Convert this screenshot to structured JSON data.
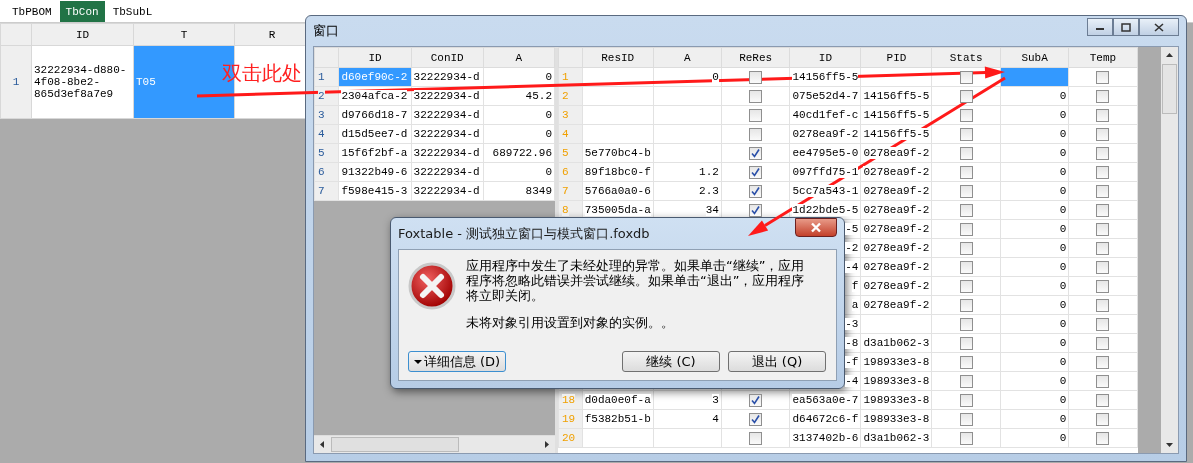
{
  "app": {
    "tabs": [
      {
        "label": "TbPBOM",
        "selected": false
      },
      {
        "label": "TbCon",
        "selected": true
      },
      {
        "label": "TbSubL",
        "selected": false
      }
    ],
    "table": {
      "columns": [
        "ID",
        "T",
        "R"
      ],
      "rows": [
        {
          "number": "1",
          "cells": [
            {
              "text": "32222934-d880-4f08-8be2-865d3ef8a7e9",
              "selected": false
            },
            {
              "text": "T05",
              "selected": true
            },
            {
              "selected": false
            }
          ]
        }
      ]
    },
    "note": "双击此处"
  },
  "window": {
    "title": "窗口",
    "grids": [
      {
        "columns": [
          {
            "label": "ID",
            "kind": "text"
          },
          {
            "label": "ConID",
            "kind": "text"
          },
          {
            "label": "A",
            "kind": "number"
          }
        ],
        "rows": [
          {
            "number": "1",
            "cells": [
              {
                "text": "d60ef90c-2",
                "selected": true
              },
              {
                "text": "32222934-d",
                "selected": false
              },
              {
                "text": "0",
                "selected": false
              }
            ]
          },
          {
            "number": "2",
            "cells": [
              {
                "text": "2304afca-2",
                "selected": false
              },
              {
                "text": "32222934-d",
                "selected": false
              },
              {
                "text": "45.2",
                "selected": false
              }
            ]
          },
          {
            "number": "3",
            "cells": [
              {
                "text": "d9766d18-7",
                "selected": false
              },
              {
                "text": "32222934-d",
                "selected": false
              },
              {
                "text": "0",
                "selected": false
              }
            ]
          },
          {
            "number": "4",
            "cells": [
              {
                "text": "d15d5ee7-d",
                "selected": false
              },
              {
                "text": "32222934-d",
                "selected": false
              },
              {
                "text": "0",
                "selected": false
              }
            ]
          },
          {
            "number": "5",
            "cells": [
              {
                "text": "15f6f2bf-a",
                "selected": false
              },
              {
                "text": "32222934-d",
                "selected": false
              },
              {
                "text": "689722.96",
                "selected": false
              }
            ]
          },
          {
            "number": "6",
            "cells": [
              {
                "text": "91322b49-6",
                "selected": false
              },
              {
                "text": "32222934-d",
                "selected": false
              },
              {
                "text": "0",
                "selected": false
              }
            ]
          },
          {
            "number": "7",
            "cells": [
              {
                "text": "f598e415-3",
                "selected": false
              },
              {
                "text": "32222934-d",
                "selected": false
              },
              {
                "text": "8349",
                "selected": false
              }
            ]
          }
        ]
      },
      {
        "columns": [
          {
            "label": "ResID",
            "kind": "text"
          },
          {
            "label": "A",
            "kind": "number"
          },
          {
            "label": "ReRes",
            "kind": "check"
          },
          {
            "label": "ID",
            "kind": "text"
          },
          {
            "label": "PID",
            "kind": "text"
          },
          {
            "label": "Stats",
            "kind": "check"
          },
          {
            "label": "SubA",
            "kind": "number"
          },
          {
            "label": "Temp",
            "kind": "check"
          }
        ],
        "rows": [
          {
            "number": "1",
            "cells": [
              {
                "selected": false
              },
              {
                "text": "0",
                "selected": false
              },
              {
                "checked": false,
                "selected": false
              },
              {
                "text": "14156ff5-5",
                "selected": false
              },
              {
                "selected": false
              },
              {
                "checked": false,
                "selected": false
              },
              {
                "selected": true
              },
              {
                "checked": false,
                "selected": false
              }
            ]
          },
          {
            "number": "2",
            "cells": [
              {
                "selected": false
              },
              {
                "selected": false
              },
              {
                "checked": false,
                "selected": false
              },
              {
                "text": "075e52d4-7",
                "selected": false
              },
              {
                "text": "14156ff5-5",
                "selected": false
              },
              {
                "checked": false,
                "selected": false
              },
              {
                "text": "0",
                "selected": false
              },
              {
                "checked": false,
                "selected": false
              }
            ]
          },
          {
            "number": "3",
            "cells": [
              {
                "selected": false
              },
              {
                "selected": false
              },
              {
                "checked": false,
                "selected": false
              },
              {
                "text": "40cd1fef-c",
                "selected": false
              },
              {
                "text": "14156ff5-5",
                "selected": false
              },
              {
                "checked": false,
                "selected": false
              },
              {
                "text": "0",
                "selected": false
              },
              {
                "checked": false,
                "selected": false
              }
            ]
          },
          {
            "number": "4",
            "cells": [
              {
                "selected": false
              },
              {
                "selected": false
              },
              {
                "checked": false,
                "selected": false
              },
              {
                "text": "0278ea9f-2",
                "selected": false
              },
              {
                "text": "14156ff5-5",
                "selected": false
              },
              {
                "checked": false,
                "selected": false
              },
              {
                "text": "0",
                "selected": false
              },
              {
                "checked": false,
                "selected": false
              }
            ]
          },
          {
            "number": "5",
            "cells": [
              {
                "text": "5e770bc4-b",
                "selected": false
              },
              {
                "selected": false
              },
              {
                "checked": true,
                "selected": false
              },
              {
                "text": "ee4795e5-0",
                "selected": false
              },
              {
                "text": "0278ea9f-2",
                "selected": false
              },
              {
                "checked": false,
                "selected": false
              },
              {
                "text": "0",
                "selected": false
              },
              {
                "checked": false,
                "selected": false
              }
            ]
          },
          {
            "number": "6",
            "cells": [
              {
                "text": "89f18bc0-f",
                "selected": false
              },
              {
                "text": "1.2",
                "selected": false
              },
              {
                "checked": true,
                "selected": false
              },
              {
                "text": "097ffd75-1",
                "selected": false
              },
              {
                "text": "0278ea9f-2",
                "selected": false
              },
              {
                "checked": false,
                "selected": false
              },
              {
                "text": "0",
                "selected": false
              },
              {
                "checked": false,
                "selected": false
              }
            ]
          },
          {
            "number": "7",
            "cells": [
              {
                "text": "5766a0a0-6",
                "selected": false
              },
              {
                "text": "2.3",
                "selected": false
              },
              {
                "checked": true,
                "selected": false
              },
              {
                "text": "5cc7a543-1",
                "selected": false
              },
              {
                "text": "0278ea9f-2",
                "selected": false
              },
              {
                "checked": false,
                "selected": false
              },
              {
                "text": "0",
                "selected": false
              },
              {
                "checked": false,
                "selected": false
              }
            ]
          },
          {
            "number": "8",
            "cells": [
              {
                "text": "735005da-a",
                "selected": false
              },
              {
                "text": "34",
                "selected": false
              },
              {
                "checked": true,
                "selected": false
              },
              {
                "text": "1d22bde5-5",
                "selected": false
              },
              {
                "text": "0278ea9f-2",
                "selected": false
              },
              {
                "checked": false,
                "selected": false
              },
              {
                "text": "0",
                "selected": false
              },
              {
                "checked": false,
                "selected": false
              }
            ]
          },
          {
            "cells": [
              {},
              {},
              {},
              {
                "text": "-5",
                "clipped": true,
                "selected": false
              },
              {
                "text": "0278ea9f-2",
                "selected": false
              },
              {
                "checked": false,
                "selected": false
              },
              {
                "text": "0",
                "selected": false
              },
              {
                "checked": false,
                "selected": false
              }
            ]
          },
          {
            "cells": [
              {},
              {},
              {},
              {
                "text": "-2",
                "clipped": true,
                "selected": false
              },
              {
                "text": "0278ea9f-2",
                "selected": false
              },
              {
                "checked": false,
                "selected": false
              },
              {
                "text": "0",
                "selected": false
              },
              {
                "checked": false,
                "selected": false
              }
            ]
          },
          {
            "cells": [
              {},
              {},
              {},
              {
                "text": "-4",
                "clipped": true,
                "selected": false
              },
              {
                "text": "0278ea9f-2",
                "selected": false
              },
              {
                "checked": false,
                "selected": false
              },
              {
                "text": "0",
                "selected": false
              },
              {
                "checked": false,
                "selected": false
              }
            ]
          },
          {
            "cells": [
              {},
              {},
              {},
              {
                "text": "f",
                "clipped": true,
                "selected": false
              },
              {
                "text": "0278ea9f-2",
                "selected": false
              },
              {
                "checked": false,
                "selected": false
              },
              {
                "text": "0",
                "selected": false
              },
              {
                "checked": false,
                "selected": false
              }
            ]
          },
          {
            "cells": [
              {},
              {},
              {},
              {
                "text": "a",
                "clipped": true,
                "selected": false
              },
              {
                "text": "0278ea9f-2",
                "selected": false
              },
              {
                "checked": false,
                "selected": false
              },
              {
                "text": "0",
                "selected": false
              },
              {
                "checked": false,
                "selected": false
              }
            ]
          },
          {
            "cells": [
              {},
              {},
              {},
              {
                "text": "-3",
                "clipped": true,
                "selected": false
              },
              {
                "selected": false
              },
              {
                "checked": false,
                "selected": false
              },
              {
                "text": "0",
                "selected": false
              },
              {
                "checked": false,
                "selected": false
              }
            ]
          },
          {
            "cells": [
              {},
              {},
              {},
              {
                "text": "-8",
                "clipped": true,
                "selected": false
              },
              {
                "text": "d3a1b062-3",
                "selected": false
              },
              {
                "checked": false,
                "selected": false
              },
              {
                "text": "0",
                "selected": false
              },
              {
                "checked": false,
                "selected": false
              }
            ]
          },
          {
            "cells": [
              {},
              {},
              {},
              {
                "text": "-f",
                "clipped": true,
                "selected": false
              },
              {
                "text": "198933e3-8",
                "selected": false
              },
              {
                "checked": false,
                "selected": false
              },
              {
                "text": "0",
                "selected": false
              },
              {
                "checked": false,
                "selected": false
              }
            ]
          },
          {
            "cells": [
              {},
              {},
              {},
              {
                "text": "-4",
                "clipped": true,
                "selected": false
              },
              {
                "text": "198933e3-8",
                "selected": false
              },
              {
                "checked": false,
                "selected": false
              },
              {
                "text": "0",
                "selected": false
              },
              {
                "checked": false,
                "selected": false
              }
            ]
          },
          {
            "number": "18",
            "cells": [
              {
                "text": "d0da0e0f-a",
                "selected": false
              },
              {
                "text": "3",
                "selected": false
              },
              {
                "checked": true,
                "selected": false
              },
              {
                "text": "ea563a0e-7",
                "selected": false
              },
              {
                "text": "198933e3-8",
                "selected": false
              },
              {
                "checked": false,
                "selected": false
              },
              {
                "text": "0",
                "selected": false
              },
              {
                "checked": false,
                "selected": false
              }
            ]
          },
          {
            "number": "19",
            "cells": [
              {
                "text": "f5382b51-b",
                "selected": false
              },
              {
                "text": "4",
                "selected": false
              },
              {
                "checked": true,
                "selected": false
              },
              {
                "text": "d64672c6-f",
                "selected": false
              },
              {
                "text": "198933e3-8",
                "selected": false
              },
              {
                "checked": false,
                "selected": false
              },
              {
                "text": "0",
                "selected": false
              },
              {
                "checked": false,
                "selected": false
              }
            ]
          },
          {
            "number": "20",
            "cells": [
              {
                "selected": false
              },
              {
                "selected": false
              },
              {
                "checked": false,
                "selected": false
              },
              {
                "text": "3137402b-6",
                "selected": false
              },
              {
                "text": "d3a1b062-3",
                "selected": false
              },
              {
                "checked": false,
                "selected": false
              },
              {
                "text": "0",
                "selected": false
              },
              {
                "checked": false,
                "selected": false
              }
            ]
          }
        ]
      }
    ]
  },
  "dialog": {
    "title": "Foxtable - 测试独立窗口与模式窗口.foxdb",
    "message": "应用程序中发生了未经处理的异常。如果单击“继续”，应用程序将忽略此错误并尝试继续。如果单击“退出”，应用程序将立即关闭。",
    "detail": "未将对象引用设置到对象的实例。。",
    "buttons": [
      {
        "label": "详细信息 (D)",
        "kind": "dropdown"
      },
      {
        "label": "继续 (C)",
        "kind": "push"
      },
      {
        "label": "退出 (Q)",
        "kind": "push"
      }
    ]
  }
}
